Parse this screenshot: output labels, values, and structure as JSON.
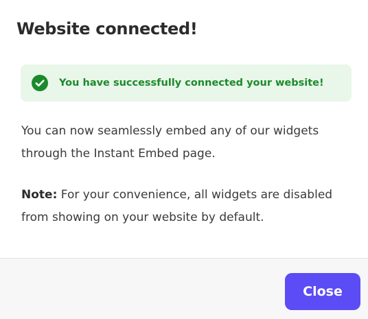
{
  "dialog": {
    "title": "Website connected!"
  },
  "alert": {
    "icon": "check-circle-icon",
    "message": "You have successfully connected your website!",
    "colors": {
      "background": "#e9f6ea",
      "text": "#1c8a2b",
      "icon": "#1c8a2b"
    }
  },
  "body": {
    "paragraph1": "You can now seamlessly embed any of our widgets through the Instant Embed page.",
    "note_label": "Note:",
    "note_text": " For your convenience, all widgets are disabled from showing on your website by default."
  },
  "footer": {
    "close_label": "Close",
    "close_color": "#5b4cf5"
  }
}
